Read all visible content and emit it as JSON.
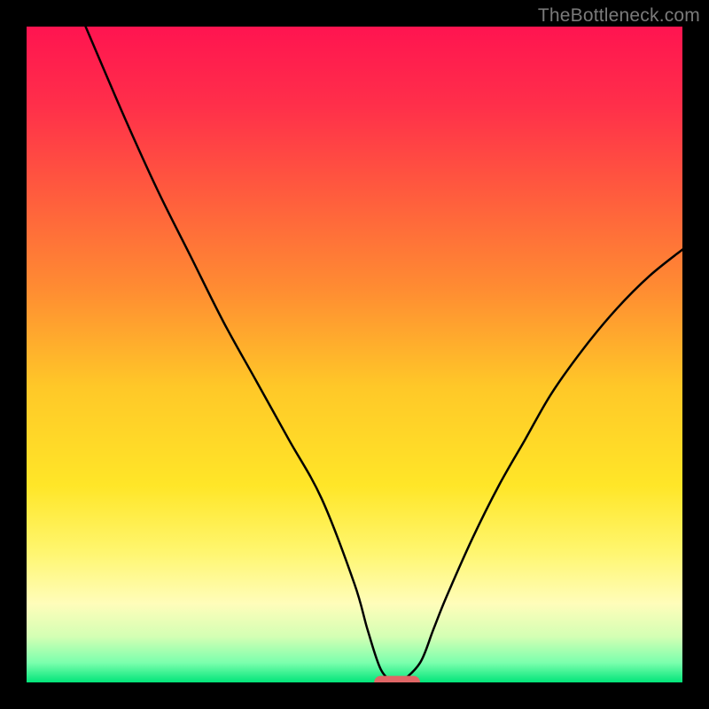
{
  "watermark": "TheBottleneck.com",
  "chart_data": {
    "type": "line",
    "title": "",
    "xlabel": "",
    "ylabel": "",
    "xlim": [
      0,
      100
    ],
    "ylim": [
      0,
      100
    ],
    "grid": false,
    "legend": false,
    "annotations": [],
    "series": [
      {
        "name": "bottleneck-curve",
        "color": "#000000",
        "x": [
          9,
          15,
          20,
          25,
          30,
          35,
          40,
          45,
          50,
          52,
          54,
          56,
          57,
          60,
          62,
          64,
          68,
          72,
          76,
          80,
          85,
          90,
          95,
          100
        ],
        "y": [
          100,
          86,
          75,
          65,
          55,
          46,
          37,
          28,
          15,
          8,
          2,
          0,
          0,
          3,
          8,
          13,
          22,
          30,
          37,
          44,
          51,
          57,
          62,
          66
        ]
      }
    ],
    "marker": {
      "name": "optimal-range",
      "shape": "capsule",
      "color": "#e06666",
      "x_center": 56.5,
      "y": 0,
      "width": 7,
      "height": 2
    },
    "background_gradient": {
      "type": "vertical",
      "stops": [
        {
          "pos": 0.0,
          "color": "#ff1450"
        },
        {
          "pos": 0.12,
          "color": "#ff2f4a"
        },
        {
          "pos": 0.25,
          "color": "#ff5a3e"
        },
        {
          "pos": 0.4,
          "color": "#ff8c32"
        },
        {
          "pos": 0.55,
          "color": "#ffc828"
        },
        {
          "pos": 0.7,
          "color": "#ffe628"
        },
        {
          "pos": 0.8,
          "color": "#fff66e"
        },
        {
          "pos": 0.88,
          "color": "#fffdba"
        },
        {
          "pos": 0.93,
          "color": "#d4ffb4"
        },
        {
          "pos": 0.97,
          "color": "#7bffad"
        },
        {
          "pos": 1.0,
          "color": "#02e57a"
        }
      ]
    }
  }
}
